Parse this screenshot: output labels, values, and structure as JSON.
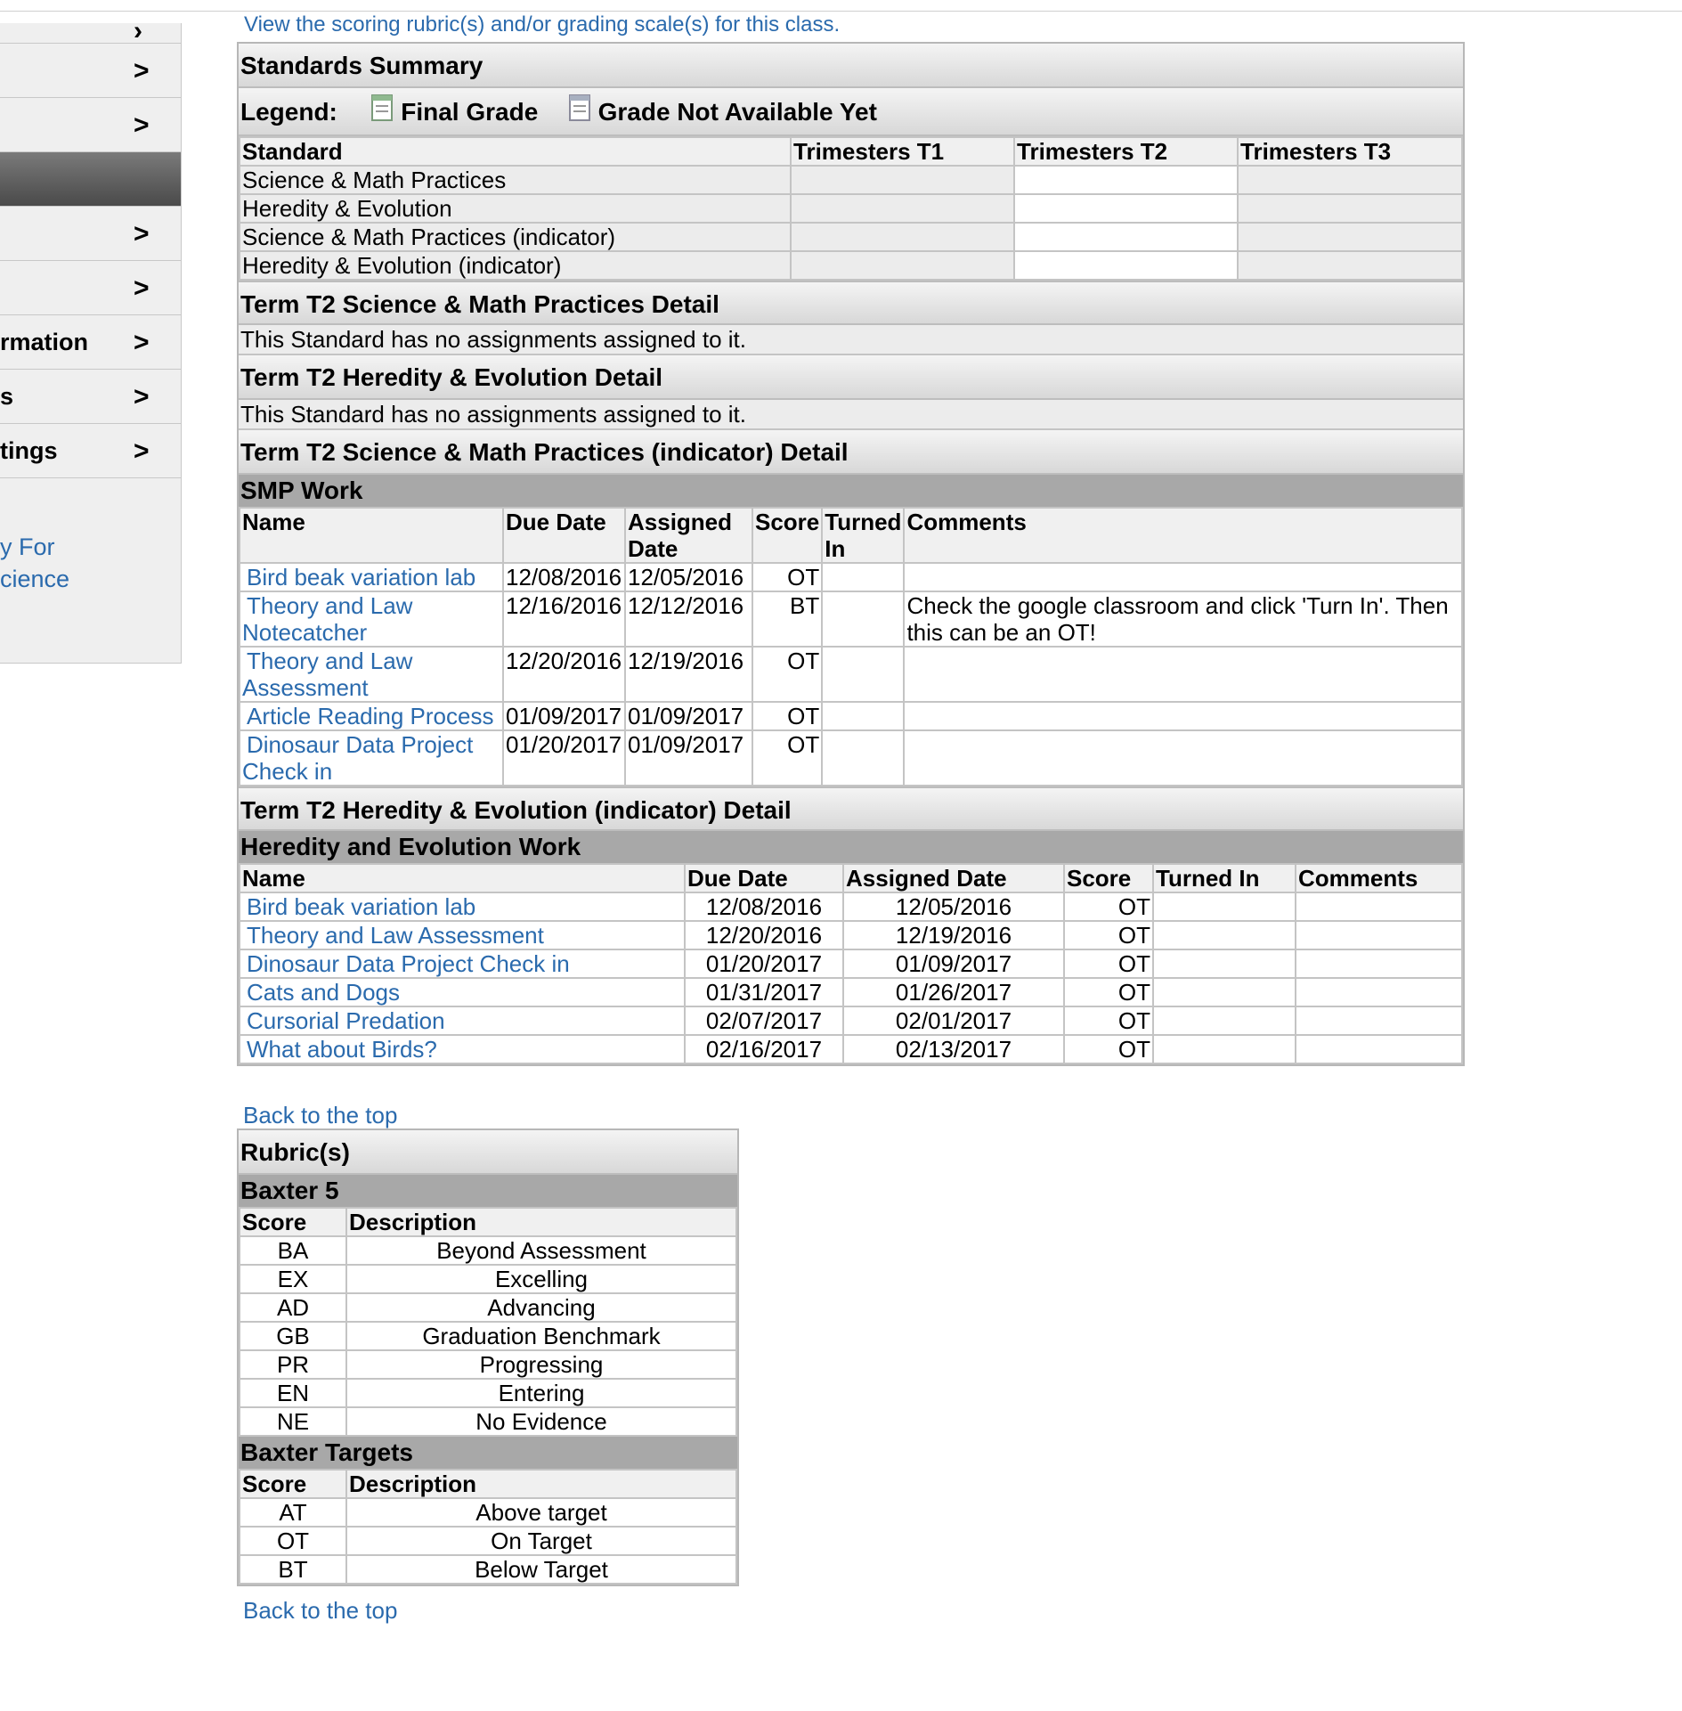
{
  "sidebar": {
    "items": [
      {
        "label": "",
        "chev": "›"
      },
      {
        "label": "",
        "chev": ">"
      },
      {
        "label": "",
        "chev": ">"
      },
      {
        "label": "",
        "chev": ""
      },
      {
        "label": "",
        "chev": ">"
      },
      {
        "label": "",
        "chev": ">"
      },
      {
        "label": "rmation",
        "chev": ">"
      },
      {
        "label": "s",
        "chev": ">"
      },
      {
        "label": "tings",
        "chev": ">"
      }
    ],
    "link_line1": "y For",
    "link_line2": "cience"
  },
  "top_link": "View the scoring rubric(s) and/or grading scale(s) for this class.",
  "summary": {
    "title": "Standards Summary",
    "legend_label": "Legend:",
    "legend_final": "Final Grade",
    "legend_na": "Grade Not Available Yet",
    "columns": [
      "Standard",
      "Trimesters T1",
      "Trimesters T2",
      "Trimesters T3"
    ],
    "rows": [
      "Science & Math Practices",
      "Heredity & Evolution",
      "Science & Math Practices (indicator)",
      "Heredity & Evolution (indicator)"
    ]
  },
  "detail_smp": {
    "title": "Term T2 Science & Math Practices Detail",
    "note": "This Standard has no assignments assigned to it."
  },
  "detail_he": {
    "title": "Term T2 Heredity & Evolution Detail",
    "note": "This Standard has no assignments assigned to it."
  },
  "detail_smp_ind": {
    "title": "Term T2 Science & Math Practices (indicator) Detail",
    "group": "SMP Work",
    "columns": [
      "Name",
      "Due Date",
      "Assigned Date",
      "Score",
      "Turned In",
      "Comments"
    ],
    "rows": [
      {
        "name": "Bird beak variation lab",
        "due": "12/08/2016",
        "assigned": "12/05/2016",
        "score": "OT",
        "turned": "",
        "comments": ""
      },
      {
        "name": "Theory and Law Notecatcher",
        "due": "12/16/2016",
        "assigned": "12/12/2016",
        "score": "BT",
        "turned": "",
        "comments": "Check the google classroom and click 'Turn In'. Then this can be an OT!"
      },
      {
        "name": "Theory and Law Assessment",
        "due": "12/20/2016",
        "assigned": "12/19/2016",
        "score": "OT",
        "turned": "",
        "comments": ""
      },
      {
        "name": "Article Reading Process",
        "due": "01/09/2017",
        "assigned": "01/09/2017",
        "score": "OT",
        "turned": "",
        "comments": ""
      },
      {
        "name": "Dinosaur Data Project Check in",
        "due": "01/20/2017",
        "assigned": "01/09/2017",
        "score": "OT",
        "turned": "",
        "comments": ""
      }
    ]
  },
  "detail_he_ind": {
    "title": "Term T2 Heredity & Evolution (indicator) Detail",
    "group": "Heredity and Evolution Work",
    "columns": [
      "Name",
      "Due Date",
      "Assigned Date",
      "Score",
      "Turned In",
      "Comments"
    ],
    "rows": [
      {
        "name": "Bird beak variation lab",
        "due": "12/08/2016",
        "assigned": "12/05/2016",
        "score": "OT"
      },
      {
        "name": "Theory and Law Assessment",
        "due": "12/20/2016",
        "assigned": "12/19/2016",
        "score": "OT"
      },
      {
        "name": "Dinosaur Data Project Check in",
        "due": "01/20/2017",
        "assigned": "01/09/2017",
        "score": "OT"
      },
      {
        "name": "Cats and Dogs",
        "due": "01/31/2017",
        "assigned": "01/26/2017",
        "score": "OT"
      },
      {
        "name": "Cursorial Predation",
        "due": "02/07/2017",
        "assigned": "02/01/2017",
        "score": "OT"
      },
      {
        "name": "What about Birds?",
        "due": "02/16/2017",
        "assigned": "02/13/2017",
        "score": "OT"
      }
    ]
  },
  "back_to_top": "Back to the top",
  "rubrics": {
    "title": "Rubric(s)",
    "groups": [
      {
        "name": "Baxter 5",
        "columns": [
          "Score",
          "Description"
        ],
        "rows": [
          [
            "BA",
            "Beyond Assessment"
          ],
          [
            "EX",
            "Excelling"
          ],
          [
            "AD",
            "Advancing"
          ],
          [
            "GB",
            "Graduation Benchmark"
          ],
          [
            "PR",
            "Progressing"
          ],
          [
            "EN",
            "Entering"
          ],
          [
            "NE",
            "No Evidence"
          ]
        ]
      },
      {
        "name": "Baxter Targets",
        "columns": [
          "Score",
          "Description"
        ],
        "rows": [
          [
            "AT",
            "Above target"
          ],
          [
            "OT",
            "On Target"
          ],
          [
            "BT",
            "Below Target"
          ]
        ]
      }
    ]
  }
}
